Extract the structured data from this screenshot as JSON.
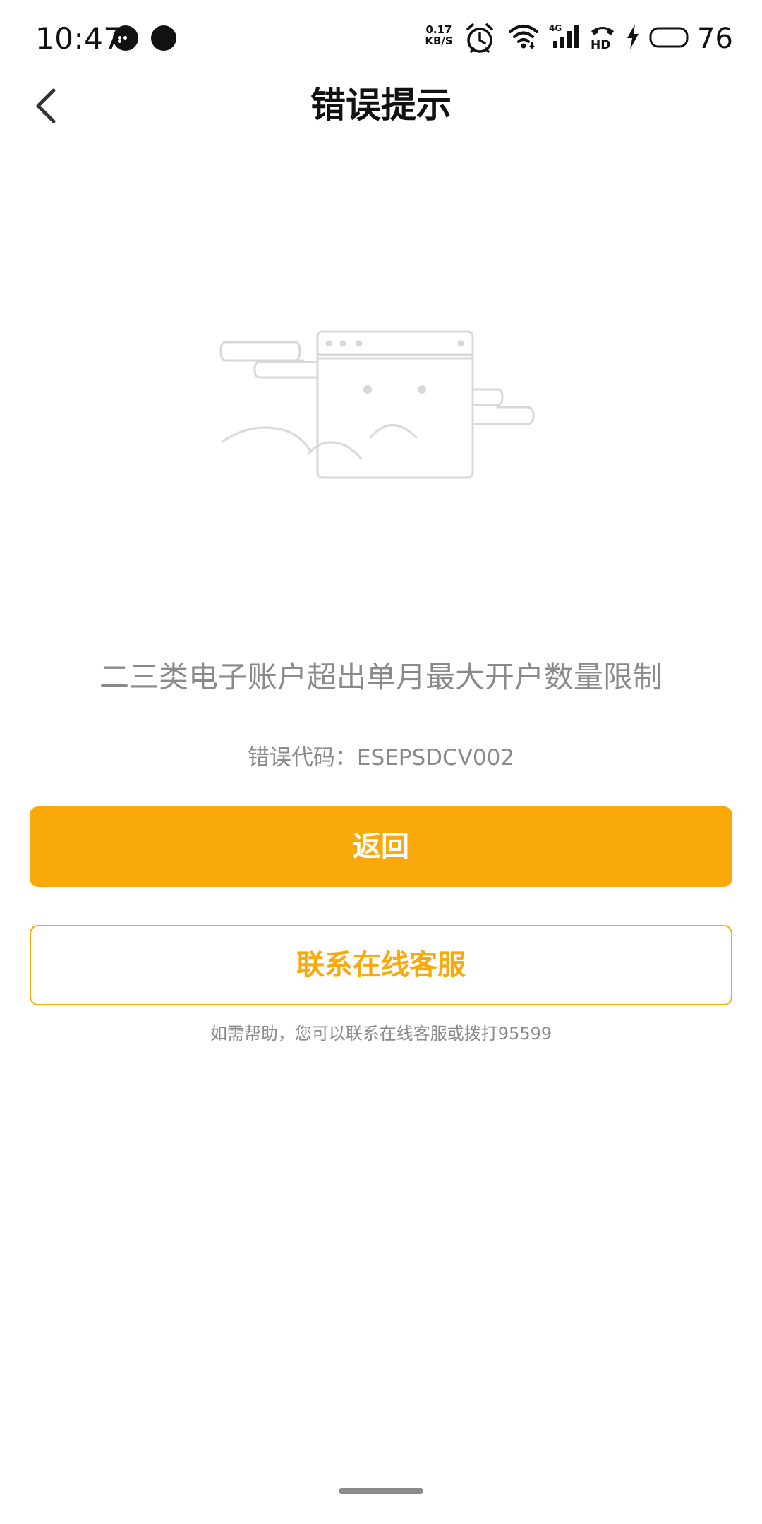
{
  "status_bar": {
    "time": "10:47",
    "net_speed_value": "0.17",
    "net_speed_unit": "KB/S",
    "network_type": "4G",
    "hd_label": "HD",
    "battery_level": "76"
  },
  "header": {
    "title": "错误提示"
  },
  "error": {
    "message": "二三类电子账户超出单月最大开户数量限制",
    "code_text": "错误代码：ESEPSDCV002"
  },
  "actions": {
    "back_label": "返回",
    "contact_label": "联系在线客服"
  },
  "help": {
    "text": "如需帮助，您可以联系在线客服或拨打95599"
  },
  "colors": {
    "accent": "#faa90b",
    "muted_text": "#8a8a8a"
  }
}
